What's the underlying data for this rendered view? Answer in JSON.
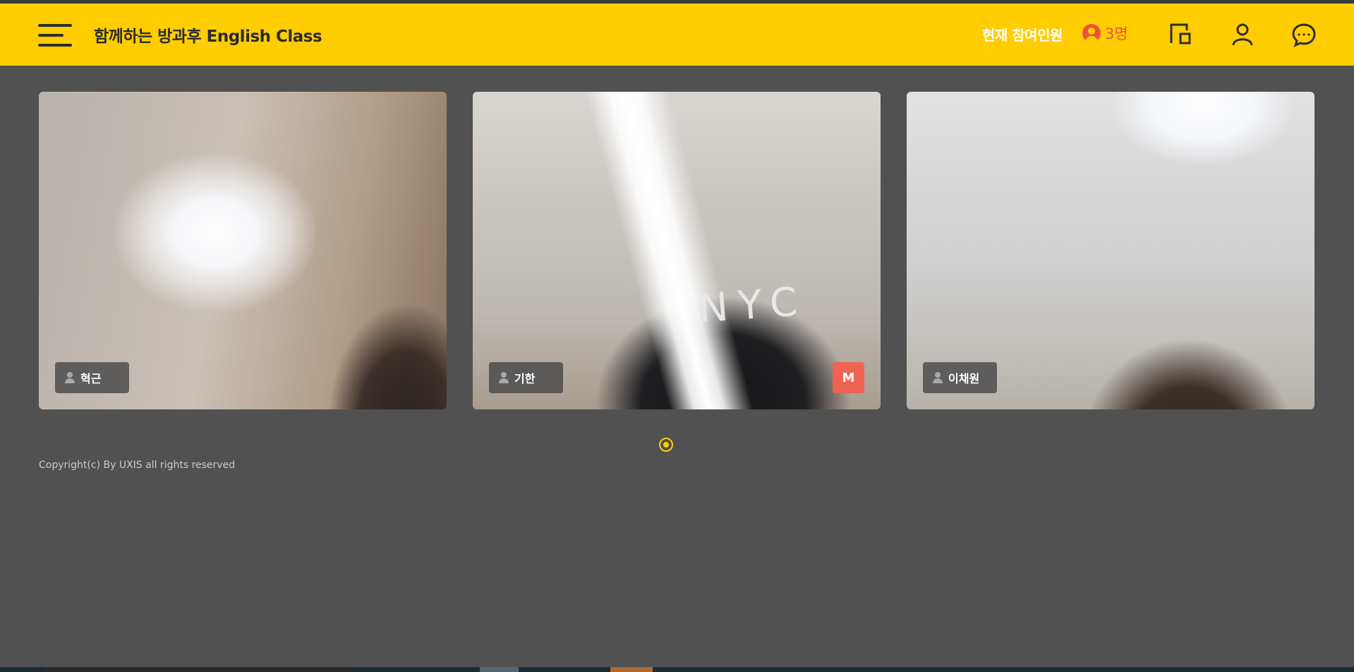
{
  "header": {
    "menu_icon": "hamburger-menu-icon",
    "title": "함께하는 방과후 English Class",
    "participants_label": "현재 참여인원",
    "participants_count": "3명",
    "icons": [
      "screen-share-icon",
      "user-icon",
      "chat-icon"
    ],
    "accent_color": "#ffcd00",
    "count_color": "#e8553e"
  },
  "tiles": [
    {
      "name": "혁근",
      "muted": false
    },
    {
      "name": "기한",
      "muted": true,
      "badge": "M",
      "overlay_text": "NYC"
    },
    {
      "name": "이채원",
      "muted": false
    }
  ],
  "pagination": {
    "pages": 1,
    "current": 1
  },
  "footer": {
    "copyright": "Copyright(c) By UXIS all rights reserved"
  }
}
